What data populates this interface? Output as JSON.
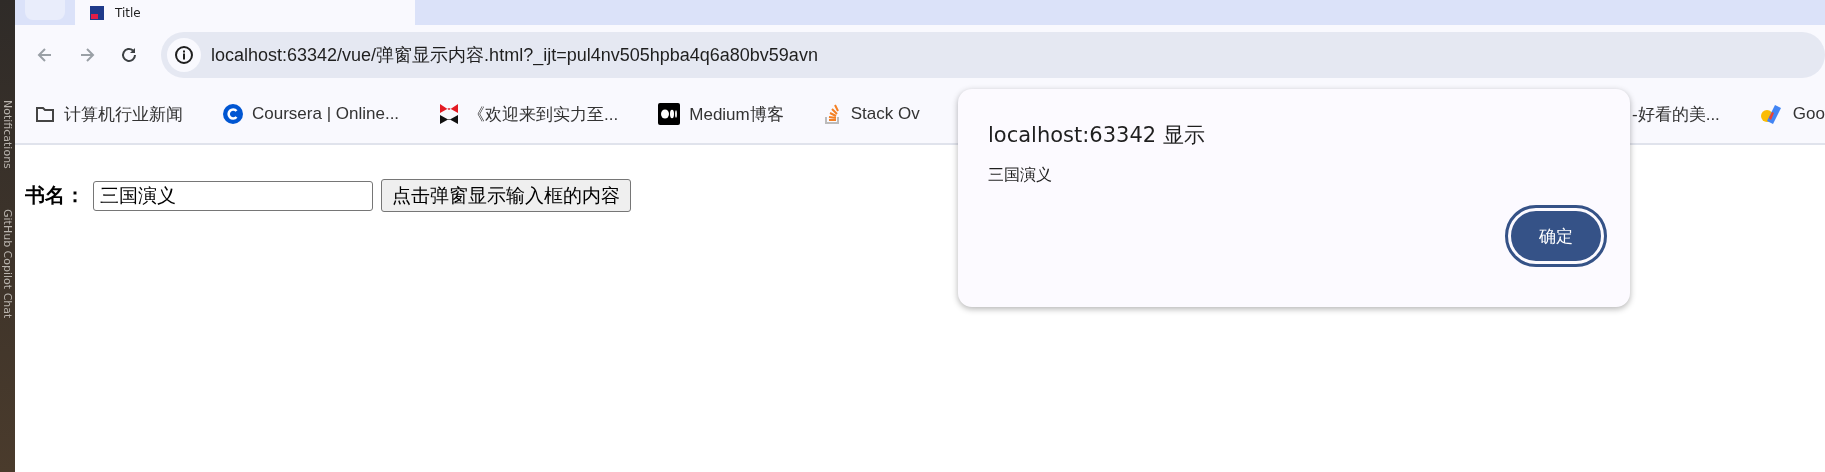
{
  "ide_sidebar": {
    "labels": [
      "Notifications",
      "GitHub Copilot Chat"
    ]
  },
  "tab": {
    "title": "Title"
  },
  "address_bar": {
    "url": "localhost:63342/vue/弹窗显示内容.html?_ijt=pul4nv505hpba4q6a80bv59avn"
  },
  "bookmarks": [
    {
      "label": "计算机行业新闻",
      "kind": "folder"
    },
    {
      "label": "Coursera | Online...",
      "kind": "coursera"
    },
    {
      "label": "《欢迎来到实力至...",
      "kind": "mw"
    },
    {
      "label": "Medium博客",
      "kind": "medium"
    },
    {
      "label": "Stack Ov",
      "kind": "stack"
    },
    {
      "label": "-好看的美...",
      "kind": "none"
    },
    {
      "label": "Goo",
      "kind": "google"
    }
  ],
  "page": {
    "label": "书名：",
    "input_value": "三国演义",
    "button": "点击弹窗显示输入框的内容"
  },
  "dialog": {
    "title": "localhost:63342 显示",
    "message": "三国演义",
    "ok_button": "确定"
  }
}
